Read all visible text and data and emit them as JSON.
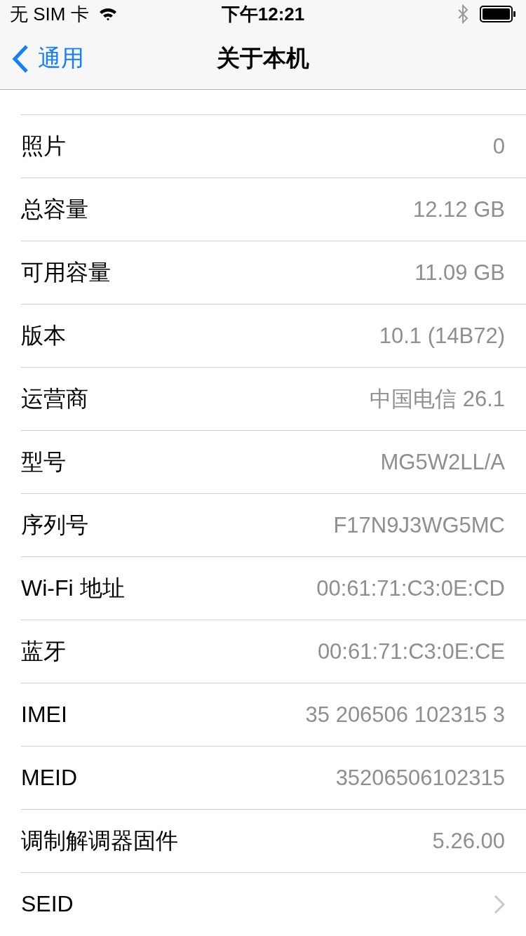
{
  "status_bar": {
    "carrier": "无 SIM 卡",
    "time": "下午12:21"
  },
  "nav_bar": {
    "back": "通用",
    "title": "关于本机"
  },
  "rows": [
    {
      "label": "照片",
      "value": "0",
      "kind": "value"
    },
    {
      "label": "总容量",
      "value": "12.12 GB",
      "kind": "value"
    },
    {
      "label": "可用容量",
      "value": "11.09 GB",
      "kind": "value"
    },
    {
      "label": "版本",
      "value": "10.1 (14B72)",
      "kind": "value"
    },
    {
      "label": "运营商",
      "value": "中国电信 26.1",
      "kind": "value"
    },
    {
      "label": "型号",
      "value": "MG5W2LL/A",
      "kind": "value"
    },
    {
      "label": "序列号",
      "value": "F17N9J3WG5MC",
      "kind": "value"
    },
    {
      "label": "Wi-Fi 地址",
      "value": "00:61:71:C3:0E:CD",
      "kind": "value"
    },
    {
      "label": "蓝牙",
      "value": "00:61:71:C3:0E:CE",
      "kind": "value"
    },
    {
      "label": "IMEI",
      "value": "35 206506 102315 3",
      "kind": "value"
    },
    {
      "label": "MEID",
      "value": "35206506102315",
      "kind": "value"
    },
    {
      "label": "调制解调器固件",
      "value": "5.26.00",
      "kind": "value"
    },
    {
      "label": "SEID",
      "kind": "chevron"
    }
  ]
}
